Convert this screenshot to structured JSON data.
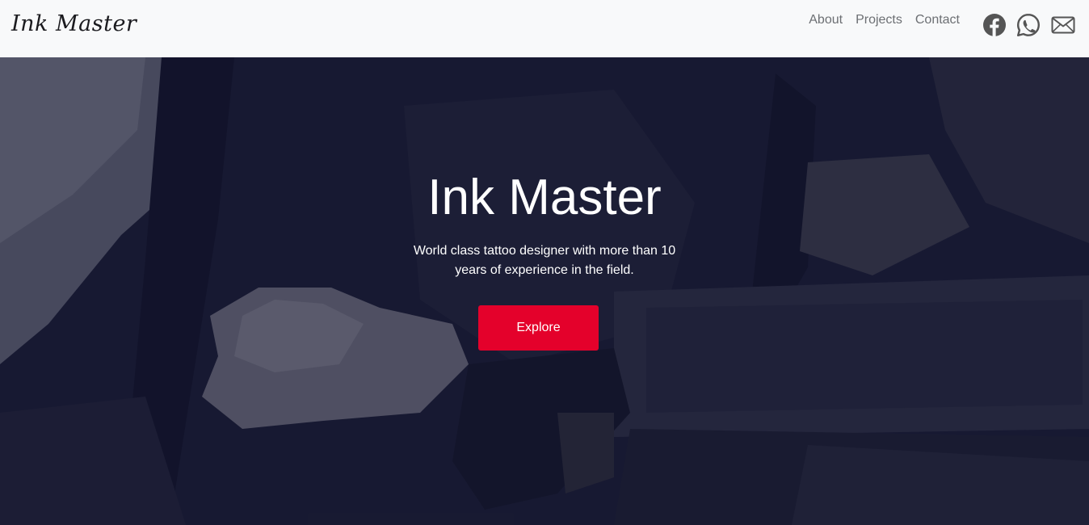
{
  "navbar": {
    "brand": "Ink Master",
    "links": [
      "About",
      "Projects",
      "Contact"
    ],
    "icons": [
      "facebook-icon",
      "whatsapp-icon",
      "envelope-icon"
    ],
    "icon_color": "#555555",
    "background": "#f8f9fa"
  },
  "hero": {
    "title": "Ink Master",
    "subtitle": "World class tattoo designer with more than 10 years of experience in the field.",
    "button_label": "Explore",
    "button_color": "#e4012b",
    "overlay_color": "#11132c"
  }
}
